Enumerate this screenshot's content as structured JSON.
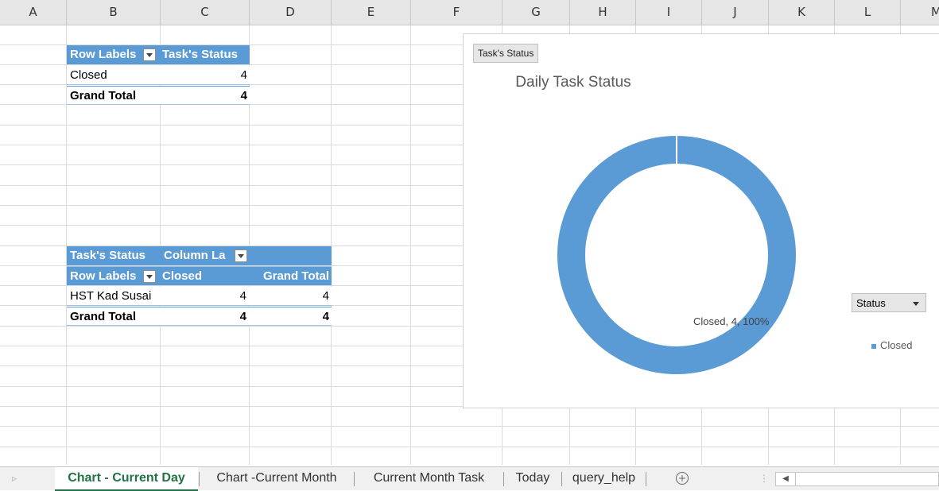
{
  "columns": [
    "A",
    "B",
    "C",
    "D",
    "E",
    "F",
    "G",
    "H",
    "I",
    "J",
    "K",
    "L",
    "M"
  ],
  "pivot1": {
    "header": {
      "row_labels": "Row Labels",
      "value_header": "Task's Status"
    },
    "rows": [
      {
        "label": "Closed",
        "value": "4"
      }
    ],
    "total": {
      "label": "Grand Total",
      "value": "4"
    }
  },
  "pivot2": {
    "row1": {
      "filter_label": "Task's Status",
      "column_labels": "Column La"
    },
    "row2": {
      "row_labels": "Row Labels",
      "closed": "Closed",
      "grand_total": "Grand Total"
    },
    "rows": [
      {
        "label": "HST Kad Susai",
        "closed": "4",
        "total": "4"
      }
    ],
    "total": {
      "label": "Grand Total",
      "closed": "4",
      "total": "4"
    }
  },
  "chart": {
    "field_button": "Task's Status",
    "legend_field": "Status",
    "legend_item": "Closed",
    "data_label": "Closed, 4, 100%",
    "color": "#5b9bd5"
  },
  "chart_data": {
    "type": "pie",
    "title": "Daily Task Status",
    "categories": [
      "Closed"
    ],
    "values": [
      4
    ],
    "percent": [
      100
    ],
    "donut": true,
    "legend": "right"
  },
  "tabs": [
    "Chart - Current Day",
    "Chart -Current Month",
    "Current Month Task",
    "Today",
    "query_help"
  ],
  "active_tab": "Chart - Current Day",
  "icons": {
    "new_sheet": "plus-circle-icon",
    "scroll_left": "caret-left-icon"
  }
}
